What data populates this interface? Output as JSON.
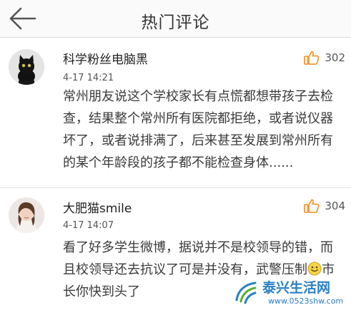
{
  "header": {
    "title": "热门评论"
  },
  "comments": [
    {
      "username": "科学粉丝电脑黑",
      "time": "4-17 14:21",
      "likes": "302",
      "content": "常州朋友说这个学校家长有点慌都想带孩子去检查，结果整个常州所有医院都拒绝，或者说仪器坏了，或者说排满了，后来甚至发展到常州所有的某个年龄段的孩子都不能检查身体......"
    },
    {
      "username": "大肥猫smile",
      "time": "4-17 14:07",
      "likes": "304",
      "content_before_emoji": "看了好多学生微博，据说并不是校领导的错，而且校领导还去抗议了可是并没有，武警压制",
      "content_after_emoji": "市长你快到头了"
    }
  ],
  "watermark": {
    "title": "泰兴生活网",
    "url": "www.0523shw.com"
  },
  "icons": {
    "back": "back-arrow-icon",
    "like": "thumbs-up-icon",
    "emoji": "smiley-emoji-icon"
  },
  "colors": {
    "like_icon": "#f29a3a",
    "watermark": "#2a7fc4"
  }
}
